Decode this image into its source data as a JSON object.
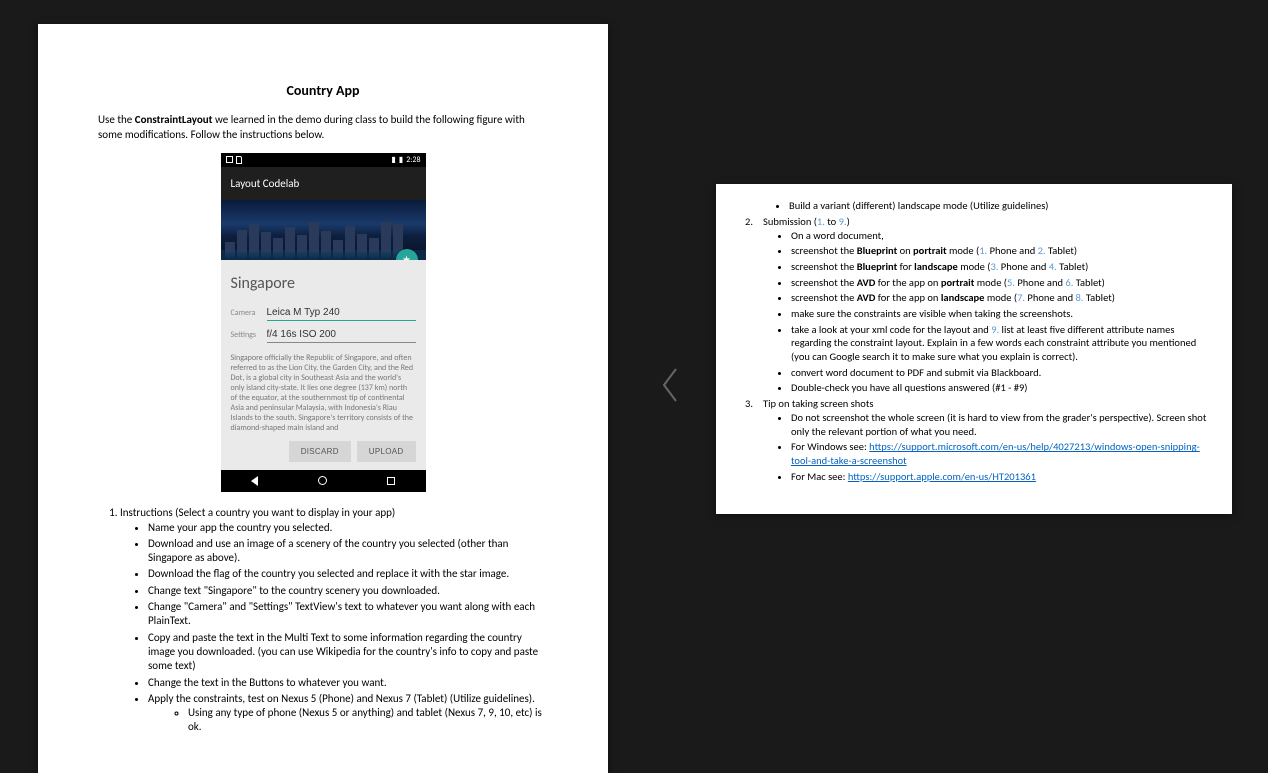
{
  "page1": {
    "title": "Country App",
    "intro_pre": "Use the ",
    "intro_bold": "ConstraintLayout",
    "intro_post": " we learned in the demo during class to build the following figure with some modifications. Follow the instructions below.",
    "phone": {
      "time": "2:28",
      "appbar_title": "Layout Codelab",
      "city": "Singapore",
      "camera_label": "Camera",
      "camera_value": "Leica M Typ 240",
      "settings_label": "Settings",
      "settings_value": "f/4 16s ISO 200",
      "description": "Singapore officially the Republic of Singapore, and often referred to as the Lion City, the Garden City, and the Red Dot, is a global city in Southeast Asia and the world's only island city-state. It lies one degree (137 km) north of the equator, at the southernmost tip of continental Asia and peninsular Malaysia, with Indonesia's Riau Islands to the south. Singapore's territory consists of the diamond-shaped main island and",
      "button_discard": "DISCARD",
      "button_upload": "UPLOAD"
    },
    "list1_heading": "Instructions (Select a country you want to display in your app)",
    "list1": {
      "i0": "Name your app the country you selected.",
      "i1": "Download and use an image of a scenery of the country you selected (other than Singapore as above).",
      "i2": "Download the flag of the country you selected and replace it with the star image.",
      "i3": "Change text \"Singapore\" to the country scenery you downloaded.",
      "i4": "Change \"Camera\" and \"Settings\" TextView's text to whatever you want along with each PlainText.",
      "i5": "Copy and paste the text in the Multi Text to some information regarding the country image you downloaded. (you can use Wikipedia for the country's info to copy and paste some text)",
      "i6": "Change the text in the Buttons to whatever you want.",
      "i7": "Apply the constraints, test on Nexus 5 (Phone) and Nexus 7 (Tablet) (Utilize guidelines).",
      "i7a": "Using any type of phone (Nexus 5 or anything) and tablet (Nexus 7, 9, 10, etc) is ok."
    }
  },
  "page2": {
    "top_bullet": "Build a variant (different) landscape mode (Utilize guidelines)",
    "submission_pre": "Submission (",
    "submission_ref1": "1.",
    "submission_mid": " to ",
    "submission_ref2": "9.",
    "submission_post": ")",
    "s": {
      "b0": "On a word document,",
      "b1_pre": "screenshot the ",
      "b1_bold1": "Blueprint",
      "b1_mid": " on ",
      "b1_bold2": "portrait",
      "b1_post": " mode (",
      "b1_r1": "1.",
      "b1_t1": " Phone and ",
      "b1_r2": "2.",
      "b1_t2": " Tablet)",
      "b2_pre": "screenshot the ",
      "b2_bold1": "Blueprint",
      "b2_mid": " for ",
      "b2_bold2": "landscape",
      "b2_post": " mode (",
      "b2_r1": "3.",
      "b2_t1": " Phone and ",
      "b2_r2": "4.",
      "b2_t2": " Tablet)",
      "b3_pre": "screenshot the ",
      "b3_bold1": "AVD",
      "b3_mid": " for the app on ",
      "b3_bold2": "portrait",
      "b3_post": " mode (",
      "b3_r1": "5.",
      "b3_t1": " Phone and ",
      "b3_r2": "6.",
      "b3_t2": " Tablet)",
      "b4_pre": "screenshot the ",
      "b4_bold1": "AVD",
      "b4_mid": " for the app on ",
      "b4_bold2": "landscape",
      "b4_post": " mode (",
      "b4_r1": "7.",
      "b4_t1": " Phone and ",
      "b4_r2": "8.",
      "b4_t2": " Tablet)",
      "b5": "make sure the constraints are visible when taking the screenshots.",
      "b6_pre": "take a look at your xml code for the layout and ",
      "b6_ref": "9.",
      "b6_post": " list at least five different attribute names regarding the constraint layout. Explain in a few words each constraint attribute you mentioned (you can Google search it to make sure what you explain is correct).",
      "b7": "convert word document to PDF and submit via Blackboard.",
      "b8": "Double-check you have all questions answered (#1 - #9)"
    },
    "tip_heading": "Tip on taking screen shots",
    "t": {
      "t0": "Do not screenshot the whole screen (it is hard to view from the grader's perspective). Screen shot only the relevant portion of what you need.",
      "t1_pre": "For Windows see: ",
      "t1_link": "https://support.microsoft.com/en-us/help/4027213/windows-open-snipping-tool-and-take-a-screenshot",
      "t2_pre": "For Mac see: ",
      "t2_link": "https://support.apple.com/en-us/HT201361"
    }
  }
}
